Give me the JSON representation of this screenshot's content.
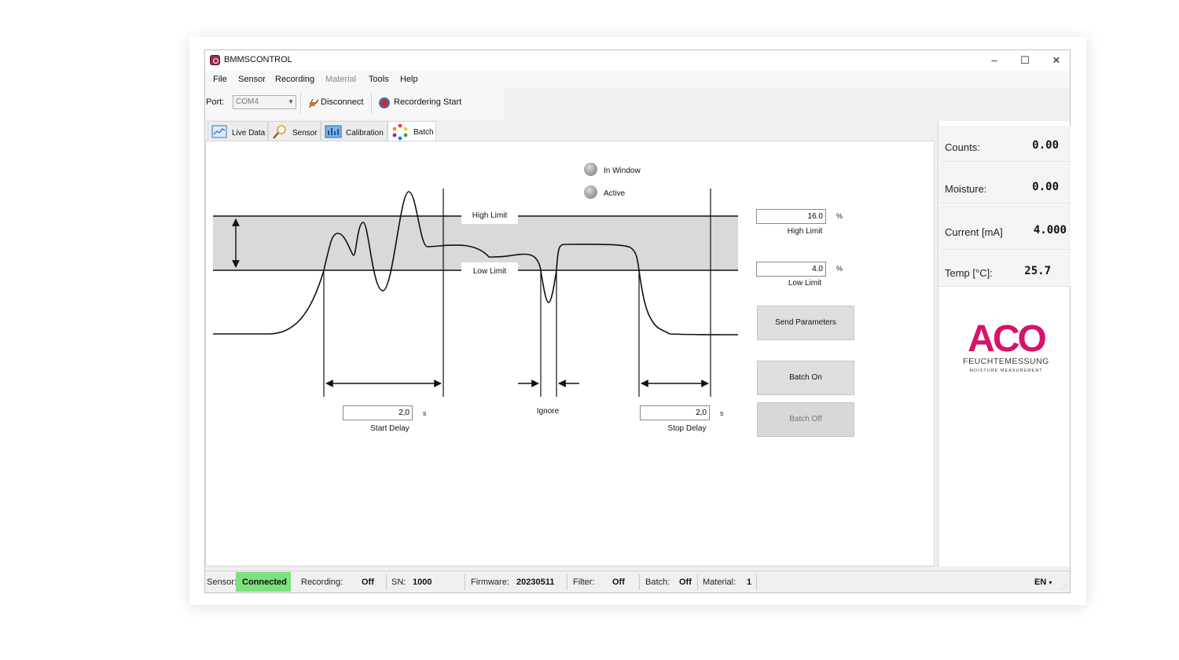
{
  "window": {
    "title": "BMMSCONTROL",
    "min_glyph": "–",
    "max_glyph": "☐",
    "close_glyph": "✕"
  },
  "menu": {
    "items": [
      "File",
      "Sensor",
      "Recording",
      "Material",
      "Tools",
      "Help"
    ]
  },
  "toolbar": {
    "port_label": "Port:",
    "port_value": "COM4",
    "disconnect_label": "Disconnect",
    "recording_label": "Recordering Start"
  },
  "tabs": [
    {
      "label": "Live Data",
      "icon": "chart-icon"
    },
    {
      "label": "Sensor",
      "icon": "magnifier-icon"
    },
    {
      "label": "Calibration",
      "icon": "calibration-icon"
    },
    {
      "label": "Batch",
      "icon": "batch-icon",
      "active": true
    }
  ],
  "batch": {
    "indicators": [
      {
        "label": "In Window"
      },
      {
        "label": "Active"
      }
    ],
    "diagram": {
      "high_limit_label": "High Limit",
      "low_limit_label": "Low Limit",
      "ignore_label": "Ignore"
    },
    "start_delay": {
      "value": "2,0",
      "unit": "s",
      "label": "Start Delay"
    },
    "stop_delay": {
      "value": "2,0",
      "unit": "s",
      "label": "Stop Delay"
    },
    "high_limit": {
      "value": "16.0",
      "unit": "%",
      "label": "High Limit"
    },
    "low_limit": {
      "value": "4.0",
      "unit": "%",
      "label": "Low Limit"
    },
    "buttons": {
      "send": "Send Parameters",
      "batch_on": "Batch On",
      "batch_off": "Batch Off"
    }
  },
  "metrics": [
    {
      "label": "Counts:",
      "value": "0.00"
    },
    {
      "label": "Moisture:",
      "value": "0.00"
    },
    {
      "label": "Current [mA]",
      "value": "4.000"
    },
    {
      "label": "Temp [°C]:",
      "value": "25.7"
    }
  ],
  "logo": {
    "text": "ACO",
    "sub1": "FEUCHTEMESSUNG",
    "sub2": "MOISTURE MEASUREMENT",
    "brand_color": "#d6136a",
    "dark_color": "#3a3a3a"
  },
  "status": {
    "sensor_label": "Sensor:",
    "sensor_value": "Connected",
    "recording_label": "Recording:",
    "recording_value": "Off",
    "sn_label": "SN:",
    "sn_value": "1000",
    "firmware_label": "Firmware:",
    "firmware_value": "20230511",
    "filter_label": "Filter:",
    "filter_value": "Off",
    "batch_label": "Batch:",
    "batch_value": "Off",
    "material_label": "Material:",
    "material_value": "1",
    "language": "EN"
  }
}
